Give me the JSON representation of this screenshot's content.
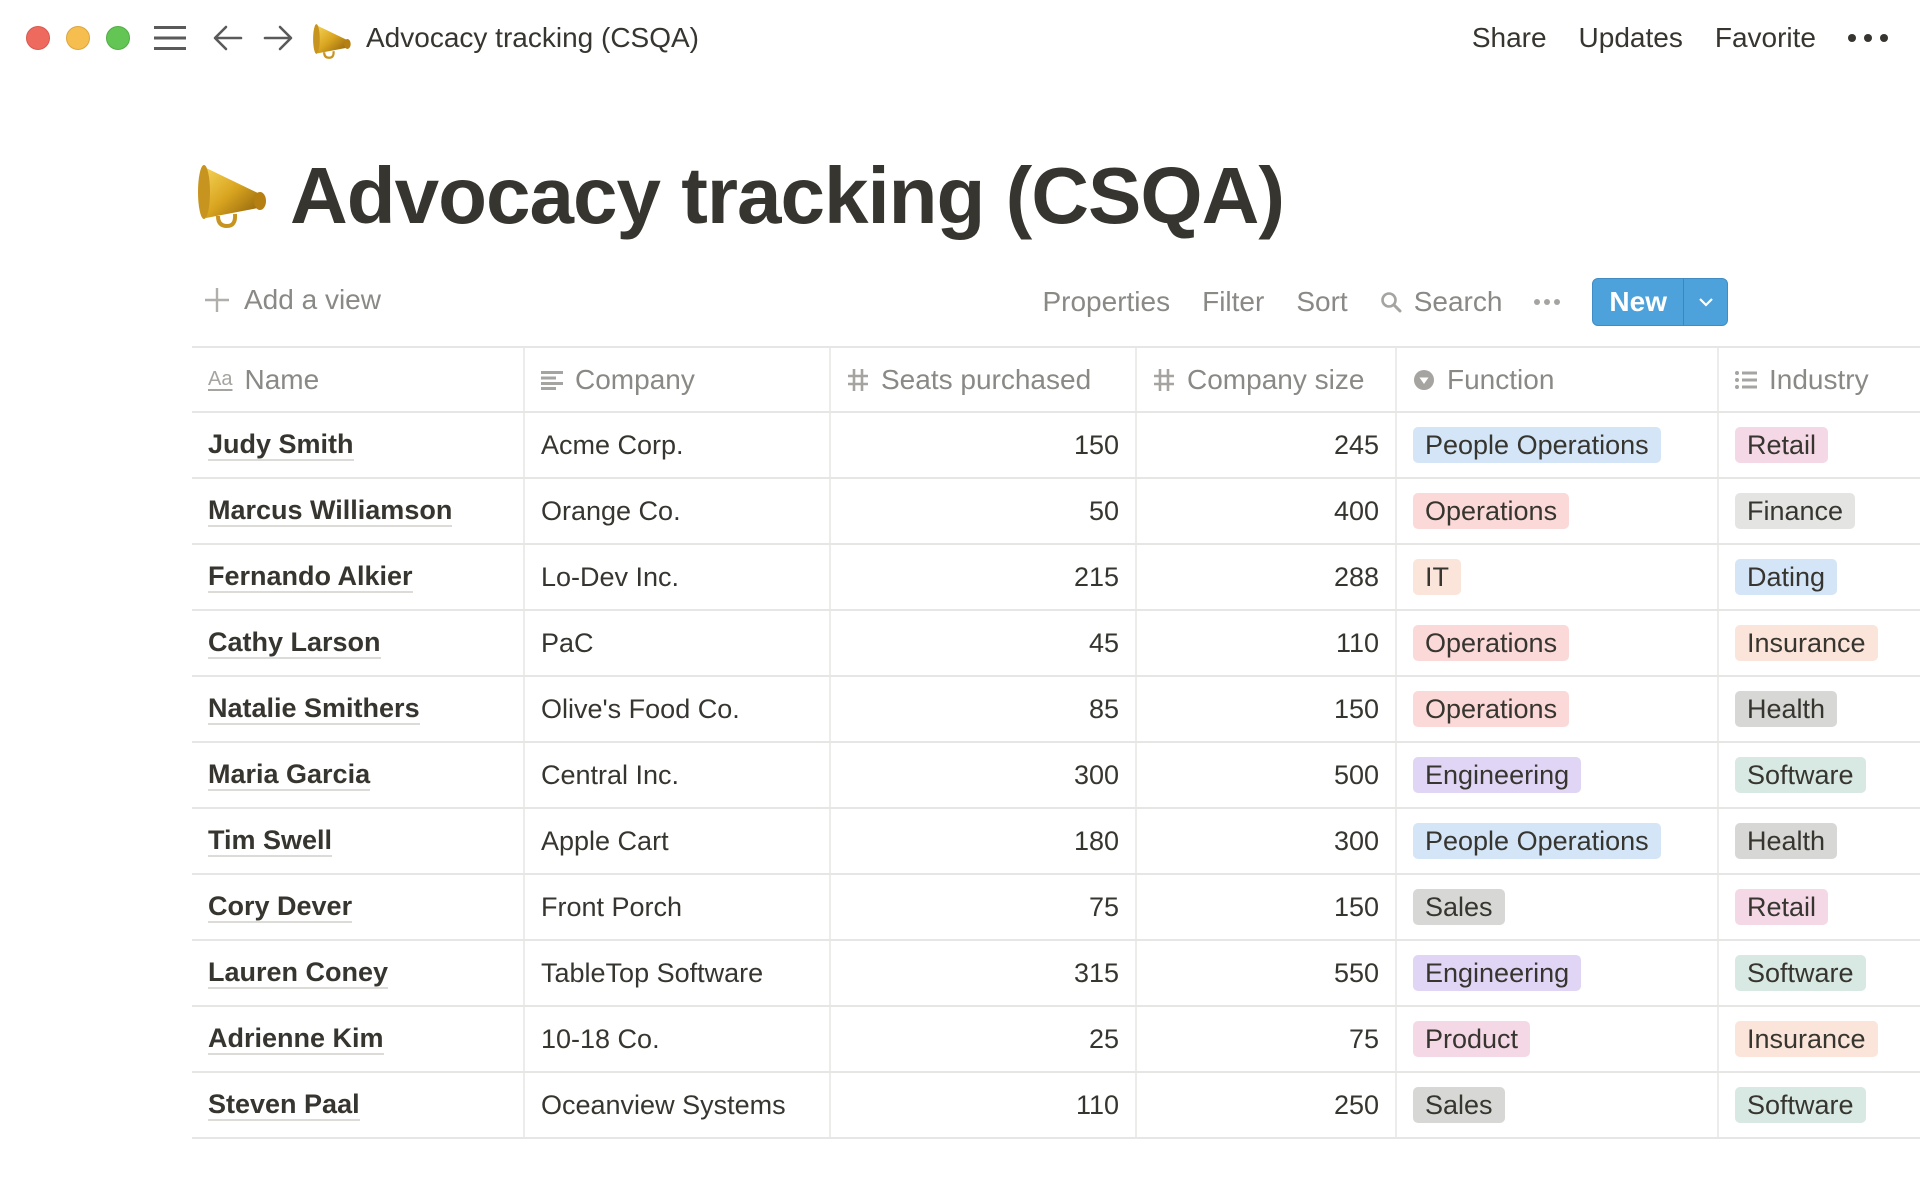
{
  "window": {
    "title": "Advocacy tracking (CSQA)",
    "page_icon": "megaphone-icon",
    "actions": [
      "Share",
      "Updates",
      "Favorite"
    ],
    "more_icon": "more-horizontal-icon"
  },
  "page": {
    "title": "Advocacy tracking (CSQA)"
  },
  "toolbar": {
    "add_view": "Add a view",
    "properties": "Properties",
    "filter": "Filter",
    "sort": "Sort",
    "search": "Search",
    "new": "New"
  },
  "tag_colors": {
    "blue": "#d3e5f6",
    "red": "#fbd9d9",
    "orange": "#fbe4d9",
    "purple": "#e0d5f5",
    "gray": "#d7d7d5",
    "lightgray": "#e4e4e2",
    "pink": "#f5d8e6",
    "green": "#d8e8e2"
  },
  "table": {
    "columns": [
      {
        "label": "Name",
        "icon": "title-aa-icon"
      },
      {
        "label": "Company",
        "icon": "text-lines-icon"
      },
      {
        "label": "Seats purchased",
        "icon": "number-hash-icon"
      },
      {
        "label": "Company size",
        "icon": "number-hash-icon"
      },
      {
        "label": "Function",
        "icon": "select-icon"
      },
      {
        "label": "Industry",
        "icon": "multi-select-icon"
      }
    ],
    "rows": [
      {
        "name": "Judy Smith",
        "company": "Acme Corp.",
        "seats": "150",
        "size": "245",
        "function": {
          "label": "People Operations",
          "color": "blue"
        },
        "industry": {
          "label": "Retail",
          "color": "pink"
        }
      },
      {
        "name": "Marcus Williamson",
        "company": "Orange Co.",
        "seats": "50",
        "size": "400",
        "function": {
          "label": "Operations",
          "color": "red"
        },
        "industry": {
          "label": "Finance",
          "color": "lightgray"
        }
      },
      {
        "name": "Fernando Alkier",
        "company": "Lo-Dev Inc.",
        "seats": "215",
        "size": "288",
        "function": {
          "label": "IT",
          "color": "orange"
        },
        "industry": {
          "label": "Dating",
          "color": "blue"
        }
      },
      {
        "name": "Cathy Larson",
        "company": "PaC",
        "seats": "45",
        "size": "110",
        "function": {
          "label": "Operations",
          "color": "red"
        },
        "industry": {
          "label": "Insurance",
          "color": "orange"
        }
      },
      {
        "name": "Natalie Smithers",
        "company": "Olive's Food Co.",
        "seats": "85",
        "size": "150",
        "function": {
          "label": "Operations",
          "color": "red"
        },
        "industry": {
          "label": "Health",
          "color": "gray"
        }
      },
      {
        "name": "Maria Garcia",
        "company": "Central Inc.",
        "seats": "300",
        "size": "500",
        "function": {
          "label": "Engineering",
          "color": "purple"
        },
        "industry": {
          "label": "Software",
          "color": "green"
        }
      },
      {
        "name": "Tim Swell",
        "company": "Apple Cart",
        "seats": "180",
        "size": "300",
        "function": {
          "label": "People Operations",
          "color": "blue"
        },
        "industry": {
          "label": "Health",
          "color": "gray"
        }
      },
      {
        "name": "Cory Dever",
        "company": "Front Porch",
        "seats": "75",
        "size": "150",
        "function": {
          "label": "Sales",
          "color": "gray"
        },
        "industry": {
          "label": "Retail",
          "color": "pink"
        }
      },
      {
        "name": "Lauren Coney",
        "company": "TableTop Software",
        "seats": "315",
        "size": "550",
        "function": {
          "label": "Engineering",
          "color": "purple"
        },
        "industry": {
          "label": "Software",
          "color": "green"
        }
      },
      {
        "name": "Adrienne Kim",
        "company": "10-18 Co.",
        "seats": "25",
        "size": "75",
        "function": {
          "label": "Product",
          "color": "pink"
        },
        "industry": {
          "label": "Insurance",
          "color": "orange"
        }
      },
      {
        "name": "Steven Paal",
        "company": "Oceanview Systems",
        "seats": "110",
        "size": "250",
        "function": {
          "label": "Sales",
          "color": "gray"
        },
        "industry": {
          "label": "Software",
          "color": "green"
        }
      }
    ]
  }
}
